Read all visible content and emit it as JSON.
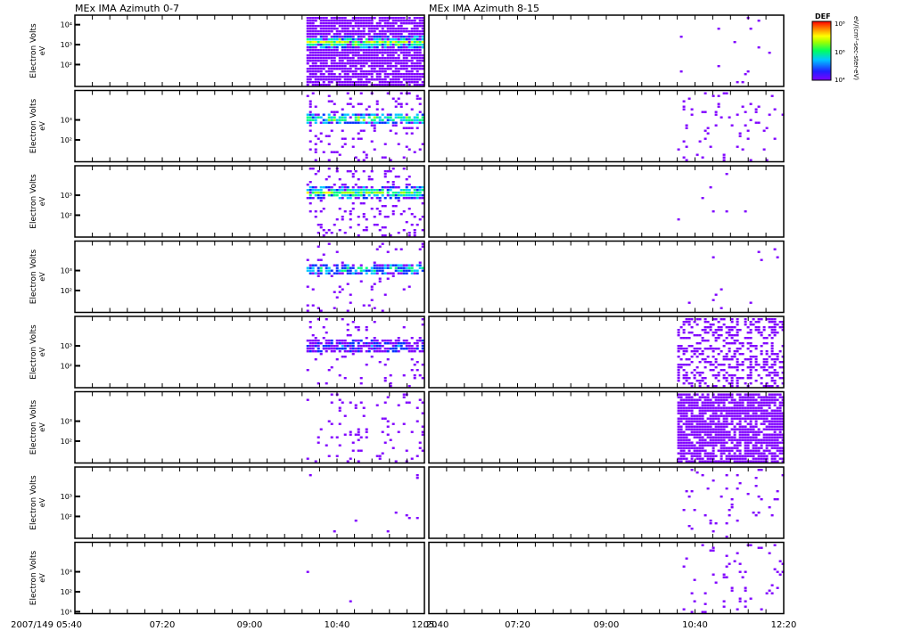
{
  "chart_data": {
    "type": "heatmap",
    "title_left": "MEx IMA Azimuth 0-7",
    "title_right": "MEx IMA Azimuth 8-15",
    "ylabel": "Electron Volts",
    "yunit": "eV",
    "yscale": "log",
    "ylim_eV": [
      8,
      30000
    ],
    "y_ticks_default": [
      "10³",
      "10²"
    ],
    "y_ticks_top": [
      "10⁴",
      "10³",
      "10²"
    ],
    "y_ticks_bottom": [
      "10³",
      "10²",
      "10¹"
    ],
    "x_start_label": "2007/149 05:40",
    "x_tick_labels": [
      "05:40",
      "07:20",
      "09:00",
      "10:40",
      "12:20"
    ],
    "xlim_minutes": [
      340,
      740
    ],
    "colorbar": {
      "title": "DEF",
      "unit": "eV/(cm²-sec-ster-eV)",
      "tick_labels": [
        "10⁸",
        "10⁶",
        "10⁴"
      ],
      "colors": [
        "#7f00ff",
        "#0030ff",
        "#00c8ff",
        "#00ff80",
        "#a0ff00",
        "#ffff00",
        "#ff8000",
        "#ff0000"
      ]
    },
    "panels_left": [
      {
        "start": "10:05",
        "background": 0.85,
        "band_eV": 1500,
        "band_level": 0.55
      },
      {
        "start": "10:05",
        "background": 0.12,
        "band_eV": 1300,
        "band_level": 0.45
      },
      {
        "start": "10:05",
        "background": 0.12,
        "band_eV": 1500,
        "band_level": 0.5
      },
      {
        "start": "10:05",
        "background": 0.05,
        "band_eV": 1300,
        "band_level": 0.35
      },
      {
        "start": "10:05",
        "background": 0.07,
        "band_eV": 1100,
        "band_level": 0.15
      },
      {
        "start": "10:05",
        "background": 0.06,
        "band_eV": 0,
        "band_level": 0
      },
      {
        "start": "10:05",
        "background": 0.006,
        "band_eV": 0,
        "band_level": 0
      },
      {
        "start": "10:05",
        "background": 0.001,
        "band_eV": 0,
        "band_level": 0
      }
    ],
    "panels_right": [
      {
        "start": "10:20",
        "background": 0.012,
        "band_eV": 0,
        "band_level": 0
      },
      {
        "start": "10:20",
        "background": 0.05,
        "band_eV": 0,
        "band_level": 0
      },
      {
        "start": "10:20",
        "background": 0.012,
        "band_eV": 0,
        "band_level": 0
      },
      {
        "start": "10:20",
        "background": 0.012,
        "band_eV": 0,
        "band_level": 0
      },
      {
        "start": "10:20",
        "background": 0.35,
        "band_eV": 0,
        "band_level": 0
      },
      {
        "start": "10:20",
        "background": 0.8,
        "band_eV": 0,
        "band_level": 0
      },
      {
        "start": "10:20",
        "background": 0.03,
        "band_eV": 0,
        "band_level": 0
      },
      {
        "start": "10:20",
        "background": 0.05,
        "band_eV": 0,
        "band_level": 0
      }
    ]
  }
}
